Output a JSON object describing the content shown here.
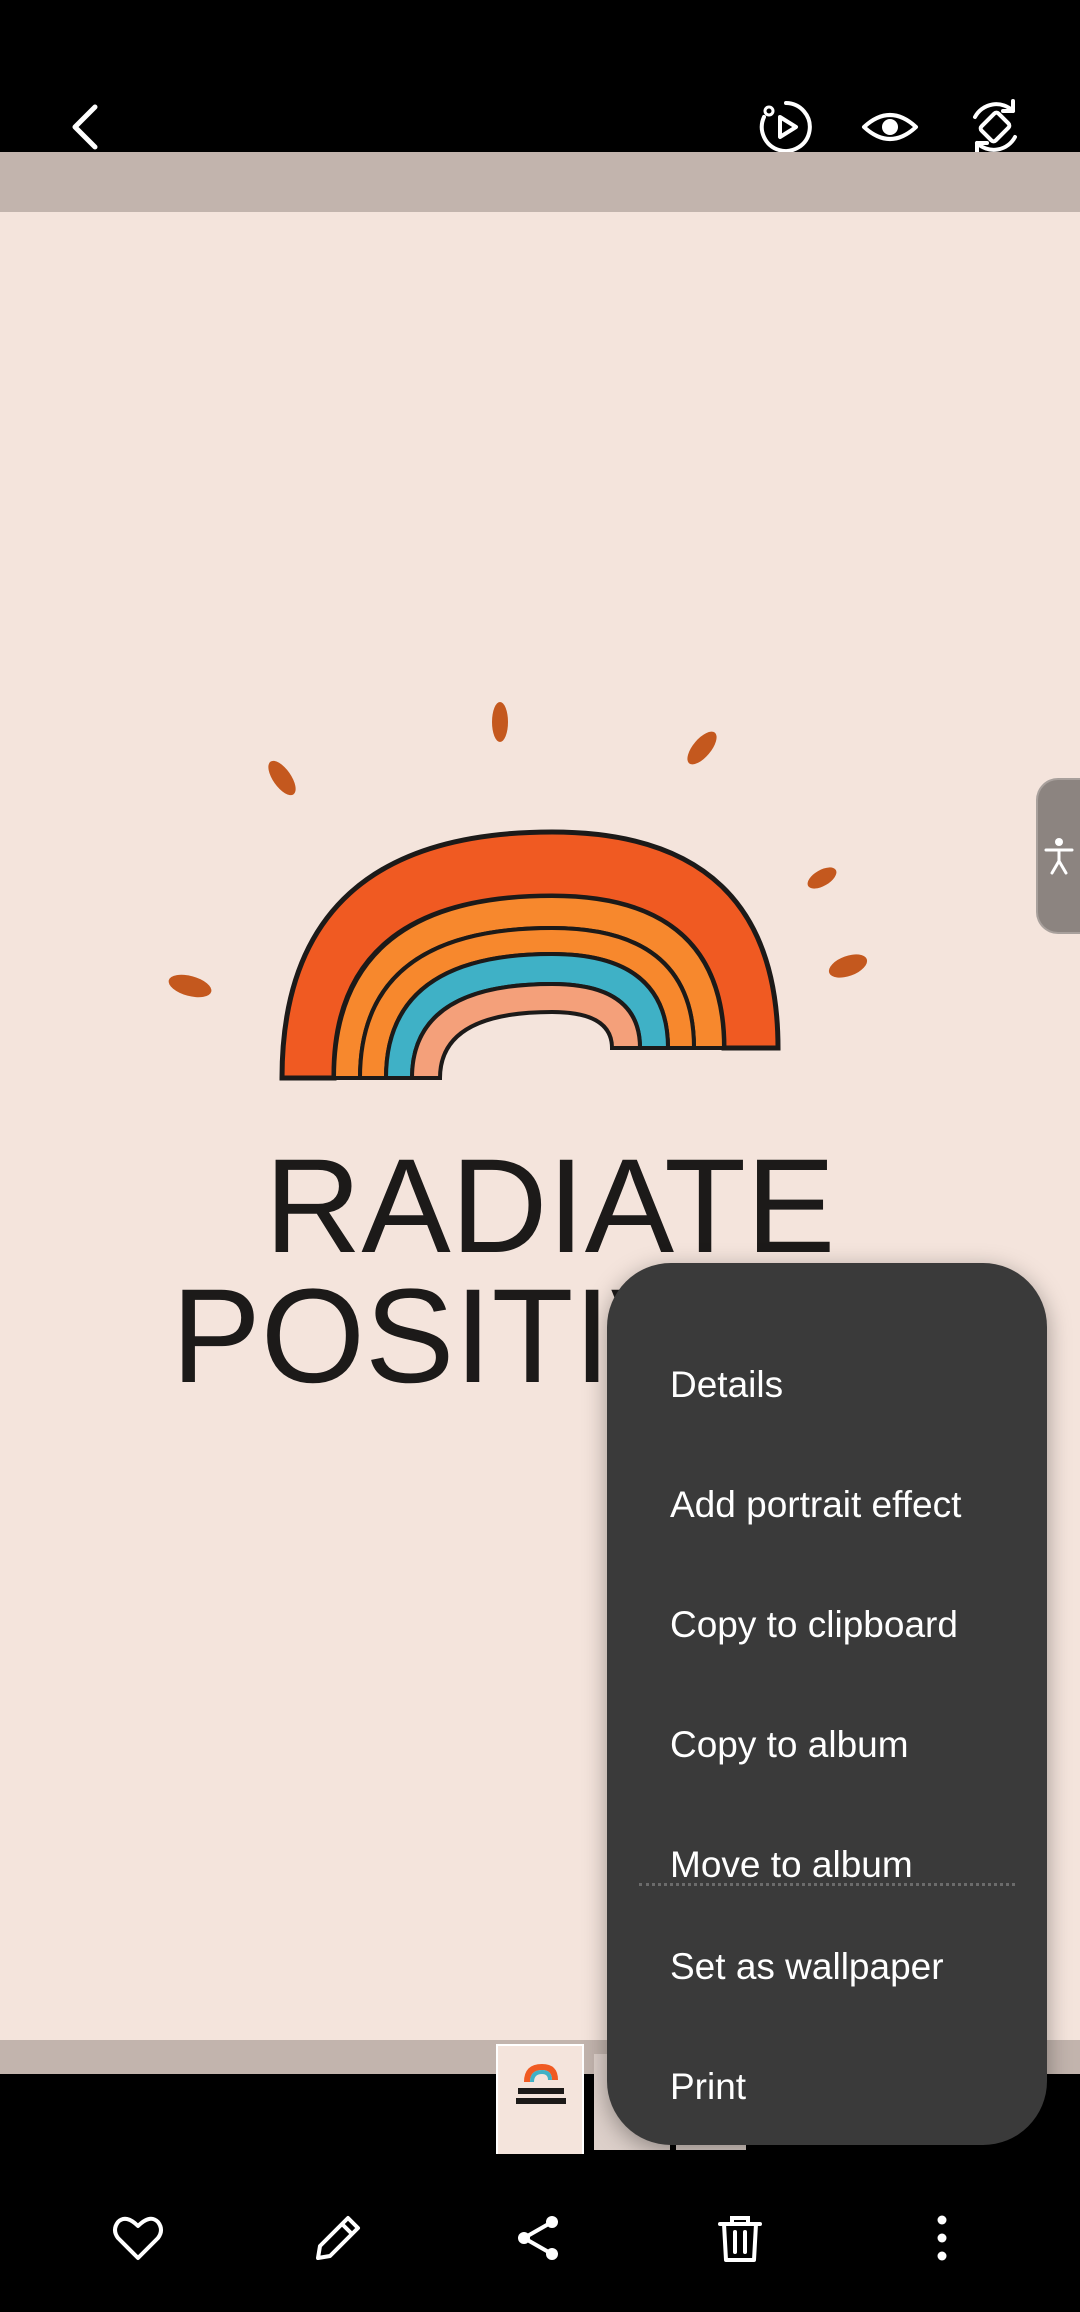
{
  "top_bar": {
    "back_icon": "chevron-left-icon",
    "actions": [
      {
        "name": "motion-photo-button",
        "icon": "motion-play-icon"
      },
      {
        "name": "eye-button",
        "icon": "eye-icon"
      },
      {
        "name": "rotate-button",
        "icon": "rotate-icon"
      }
    ]
  },
  "photo": {
    "line1": "RADIATE",
    "line2": "POSITIVITY",
    "colors": {
      "background": "#f4e4dc",
      "rainbow_outer": "#f05a22",
      "rainbow_mid": "#f7882d",
      "rainbow_teal": "#3fb1c6",
      "rainbow_inner": "#f4a07a",
      "ink": "#1c1a19",
      "ray": "#c4581e"
    }
  },
  "context_menu": {
    "items": [
      {
        "label": "Details"
      },
      {
        "label": "Add portrait effect"
      },
      {
        "label": "Copy to clipboard"
      },
      {
        "label": "Copy to album"
      },
      {
        "label": "Move to album"
      },
      {
        "label": "Set as wallpaper"
      },
      {
        "label": "Print"
      }
    ]
  },
  "bottom_bar": {
    "actions": [
      {
        "name": "favorite-button",
        "icon": "heart-icon"
      },
      {
        "name": "edit-button",
        "icon": "pencil-icon"
      },
      {
        "name": "share-button",
        "icon": "share-icon"
      },
      {
        "name": "delete-button",
        "icon": "trash-icon"
      },
      {
        "name": "more-options-button",
        "icon": "more-vertical-icon"
      }
    ]
  },
  "accessibility": {
    "icon": "accessibility-icon"
  }
}
